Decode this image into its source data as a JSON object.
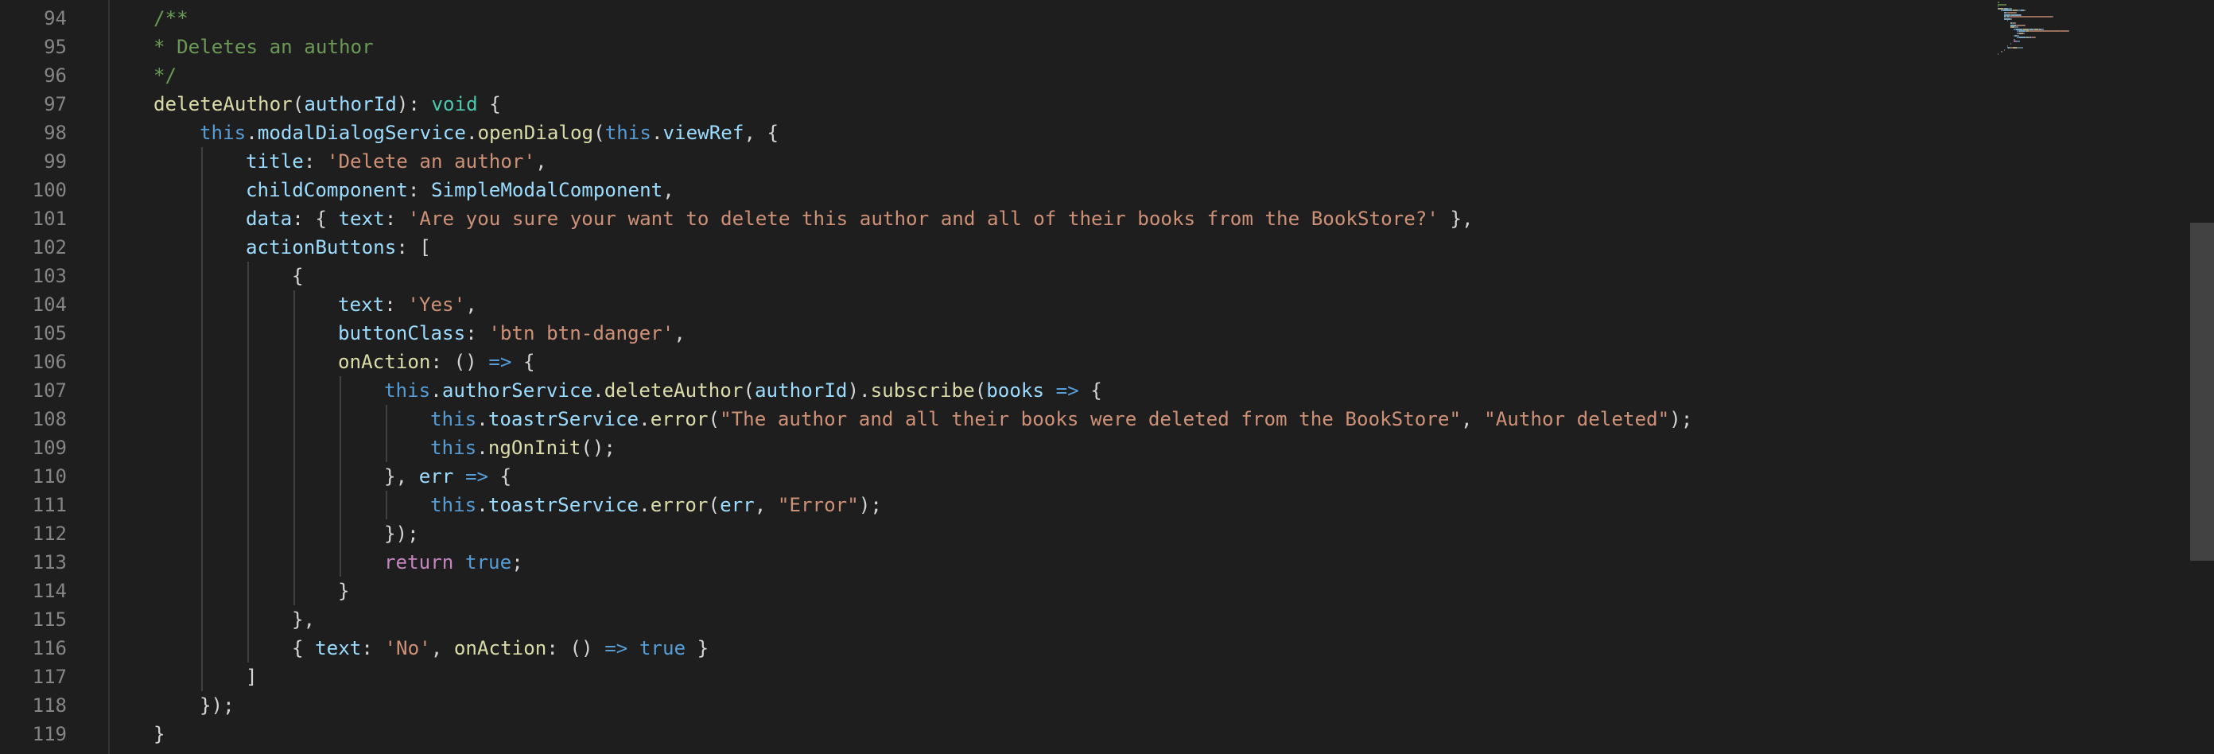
{
  "editor": {
    "colors": {
      "background": "#1e1e1e",
      "line_number": "#858585",
      "comment": "#6a9955",
      "keyword": "#569cd6",
      "control": "#c586c0",
      "string": "#ce9178",
      "function": "#dcdcaa",
      "variable": "#9cdcfe",
      "type": "#4ec9b0",
      "punctuation": "#d4d4d4"
    },
    "lines": [
      {
        "number": "94",
        "indent": 1,
        "tokens": [
          {
            "t": "cm",
            "v": "/**"
          }
        ]
      },
      {
        "number": "95",
        "indent": 1,
        "tokens": [
          {
            "t": "cm",
            "v": "* Deletes an author"
          }
        ]
      },
      {
        "number": "96",
        "indent": 1,
        "tokens": [
          {
            "t": "cm",
            "v": "*/"
          }
        ]
      },
      {
        "number": "97",
        "indent": 1,
        "tokens": [
          {
            "t": "fn",
            "v": "deleteAuthor"
          },
          {
            "t": "p",
            "v": "("
          },
          {
            "t": "var",
            "v": "authorId"
          },
          {
            "t": "p",
            "v": "): "
          },
          {
            "t": "type",
            "v": "void"
          },
          {
            "t": "p",
            "v": " {"
          }
        ]
      },
      {
        "number": "98",
        "indent": 2,
        "tokens": [
          {
            "t": "kw",
            "v": "this"
          },
          {
            "t": "p",
            "v": "."
          },
          {
            "t": "var",
            "v": "modalDialogService"
          },
          {
            "t": "p",
            "v": "."
          },
          {
            "t": "fn",
            "v": "openDialog"
          },
          {
            "t": "p",
            "v": "("
          },
          {
            "t": "kw",
            "v": "this"
          },
          {
            "t": "p",
            "v": "."
          },
          {
            "t": "var",
            "v": "viewRef"
          },
          {
            "t": "p",
            "v": ", {"
          }
        ]
      },
      {
        "number": "99",
        "indent": 3,
        "tokens": [
          {
            "t": "var",
            "v": "title"
          },
          {
            "t": "p",
            "v": ": "
          },
          {
            "t": "str",
            "v": "'Delete an author'"
          },
          {
            "t": "p",
            "v": ","
          }
        ]
      },
      {
        "number": "100",
        "indent": 3,
        "tokens": [
          {
            "t": "var",
            "v": "childComponent"
          },
          {
            "t": "p",
            "v": ": "
          },
          {
            "t": "var",
            "v": "SimpleModalComponent"
          },
          {
            "t": "p",
            "v": ","
          }
        ]
      },
      {
        "number": "101",
        "indent": 3,
        "tokens": [
          {
            "t": "var",
            "v": "data"
          },
          {
            "t": "p",
            "v": ": { "
          },
          {
            "t": "var",
            "v": "text"
          },
          {
            "t": "p",
            "v": ": "
          },
          {
            "t": "str",
            "v": "'Are you sure your want to delete this author and all of their books from the BookStore?'"
          },
          {
            "t": "p",
            "v": " },"
          }
        ]
      },
      {
        "number": "102",
        "indent": 3,
        "tokens": [
          {
            "t": "var",
            "v": "actionButtons"
          },
          {
            "t": "p",
            "v": ": ["
          }
        ]
      },
      {
        "number": "103",
        "indent": 4,
        "tokens": [
          {
            "t": "p",
            "v": "{"
          }
        ]
      },
      {
        "number": "104",
        "indent": 5,
        "tokens": [
          {
            "t": "var",
            "v": "text"
          },
          {
            "t": "p",
            "v": ": "
          },
          {
            "t": "str",
            "v": "'Yes'"
          },
          {
            "t": "p",
            "v": ","
          }
        ]
      },
      {
        "number": "105",
        "indent": 5,
        "tokens": [
          {
            "t": "var",
            "v": "buttonClass"
          },
          {
            "t": "p",
            "v": ": "
          },
          {
            "t": "str",
            "v": "'btn btn-danger'"
          },
          {
            "t": "p",
            "v": ","
          }
        ]
      },
      {
        "number": "106",
        "indent": 5,
        "tokens": [
          {
            "t": "fn",
            "v": "onAction"
          },
          {
            "t": "p",
            "v": ": () "
          },
          {
            "t": "kw",
            "v": "=>"
          },
          {
            "t": "p",
            "v": " {"
          }
        ]
      },
      {
        "number": "107",
        "indent": 6,
        "tokens": [
          {
            "t": "kw",
            "v": "this"
          },
          {
            "t": "p",
            "v": "."
          },
          {
            "t": "var",
            "v": "authorService"
          },
          {
            "t": "p",
            "v": "."
          },
          {
            "t": "fn",
            "v": "deleteAuthor"
          },
          {
            "t": "p",
            "v": "("
          },
          {
            "t": "var",
            "v": "authorId"
          },
          {
            "t": "p",
            "v": ")."
          },
          {
            "t": "fn",
            "v": "subscribe"
          },
          {
            "t": "p",
            "v": "("
          },
          {
            "t": "var",
            "v": "books"
          },
          {
            "t": "p",
            "v": " "
          },
          {
            "t": "kw",
            "v": "=>"
          },
          {
            "t": "p",
            "v": " {"
          }
        ]
      },
      {
        "number": "108",
        "indent": 7,
        "tokens": [
          {
            "t": "kw",
            "v": "this"
          },
          {
            "t": "p",
            "v": "."
          },
          {
            "t": "var",
            "v": "toastrService"
          },
          {
            "t": "p",
            "v": "."
          },
          {
            "t": "fn",
            "v": "error"
          },
          {
            "t": "p",
            "v": "("
          },
          {
            "t": "str",
            "v": "\"The author and all their books were deleted from the BookStore\""
          },
          {
            "t": "p",
            "v": ", "
          },
          {
            "t": "str",
            "v": "\"Author deleted\""
          },
          {
            "t": "p",
            "v": ");"
          }
        ]
      },
      {
        "number": "109",
        "indent": 7,
        "tokens": [
          {
            "t": "kw",
            "v": "this"
          },
          {
            "t": "p",
            "v": "."
          },
          {
            "t": "fn",
            "v": "ngOnInit"
          },
          {
            "t": "p",
            "v": "();"
          }
        ]
      },
      {
        "number": "110",
        "indent": 6,
        "tokens": [
          {
            "t": "p",
            "v": "}, "
          },
          {
            "t": "var",
            "v": "err"
          },
          {
            "t": "p",
            "v": " "
          },
          {
            "t": "kw",
            "v": "=>"
          },
          {
            "t": "p",
            "v": " {"
          }
        ]
      },
      {
        "number": "111",
        "indent": 7,
        "tokens": [
          {
            "t": "kw",
            "v": "this"
          },
          {
            "t": "p",
            "v": "."
          },
          {
            "t": "var",
            "v": "toastrService"
          },
          {
            "t": "p",
            "v": "."
          },
          {
            "t": "fn",
            "v": "error"
          },
          {
            "t": "p",
            "v": "("
          },
          {
            "t": "var",
            "v": "err"
          },
          {
            "t": "p",
            "v": ", "
          },
          {
            "t": "str",
            "v": "\"Error\""
          },
          {
            "t": "p",
            "v": ");"
          }
        ]
      },
      {
        "number": "112",
        "indent": 6,
        "tokens": [
          {
            "t": "p",
            "v": "});"
          }
        ]
      },
      {
        "number": "113",
        "indent": 6,
        "tokens": [
          {
            "t": "ctl",
            "v": "return"
          },
          {
            "t": "p",
            "v": " "
          },
          {
            "t": "kw",
            "v": "true"
          },
          {
            "t": "p",
            "v": ";"
          }
        ]
      },
      {
        "number": "114",
        "indent": 5,
        "tokens": [
          {
            "t": "p",
            "v": "}"
          }
        ]
      },
      {
        "number": "115",
        "indent": 4,
        "tokens": [
          {
            "t": "p",
            "v": "},"
          }
        ]
      },
      {
        "number": "116",
        "indent": 4,
        "tokens": [
          {
            "t": "p",
            "v": "{ "
          },
          {
            "t": "var",
            "v": "text"
          },
          {
            "t": "p",
            "v": ": "
          },
          {
            "t": "str",
            "v": "'No'"
          },
          {
            "t": "p",
            "v": ", "
          },
          {
            "t": "fn",
            "v": "onAction"
          },
          {
            "t": "p",
            "v": ": () "
          },
          {
            "t": "kw",
            "v": "=>"
          },
          {
            "t": "p",
            "v": " "
          },
          {
            "t": "kw",
            "v": "true"
          },
          {
            "t": "p",
            "v": " }"
          }
        ]
      },
      {
        "number": "117",
        "indent": 3,
        "tokens": [
          {
            "t": "p",
            "v": "]"
          }
        ]
      },
      {
        "number": "118",
        "indent": 2,
        "tokens": [
          {
            "t": "p",
            "v": "});"
          }
        ]
      },
      {
        "number": "119",
        "indent": 1,
        "tokens": [
          {
            "t": "p",
            "v": "}"
          }
        ]
      }
    ]
  }
}
